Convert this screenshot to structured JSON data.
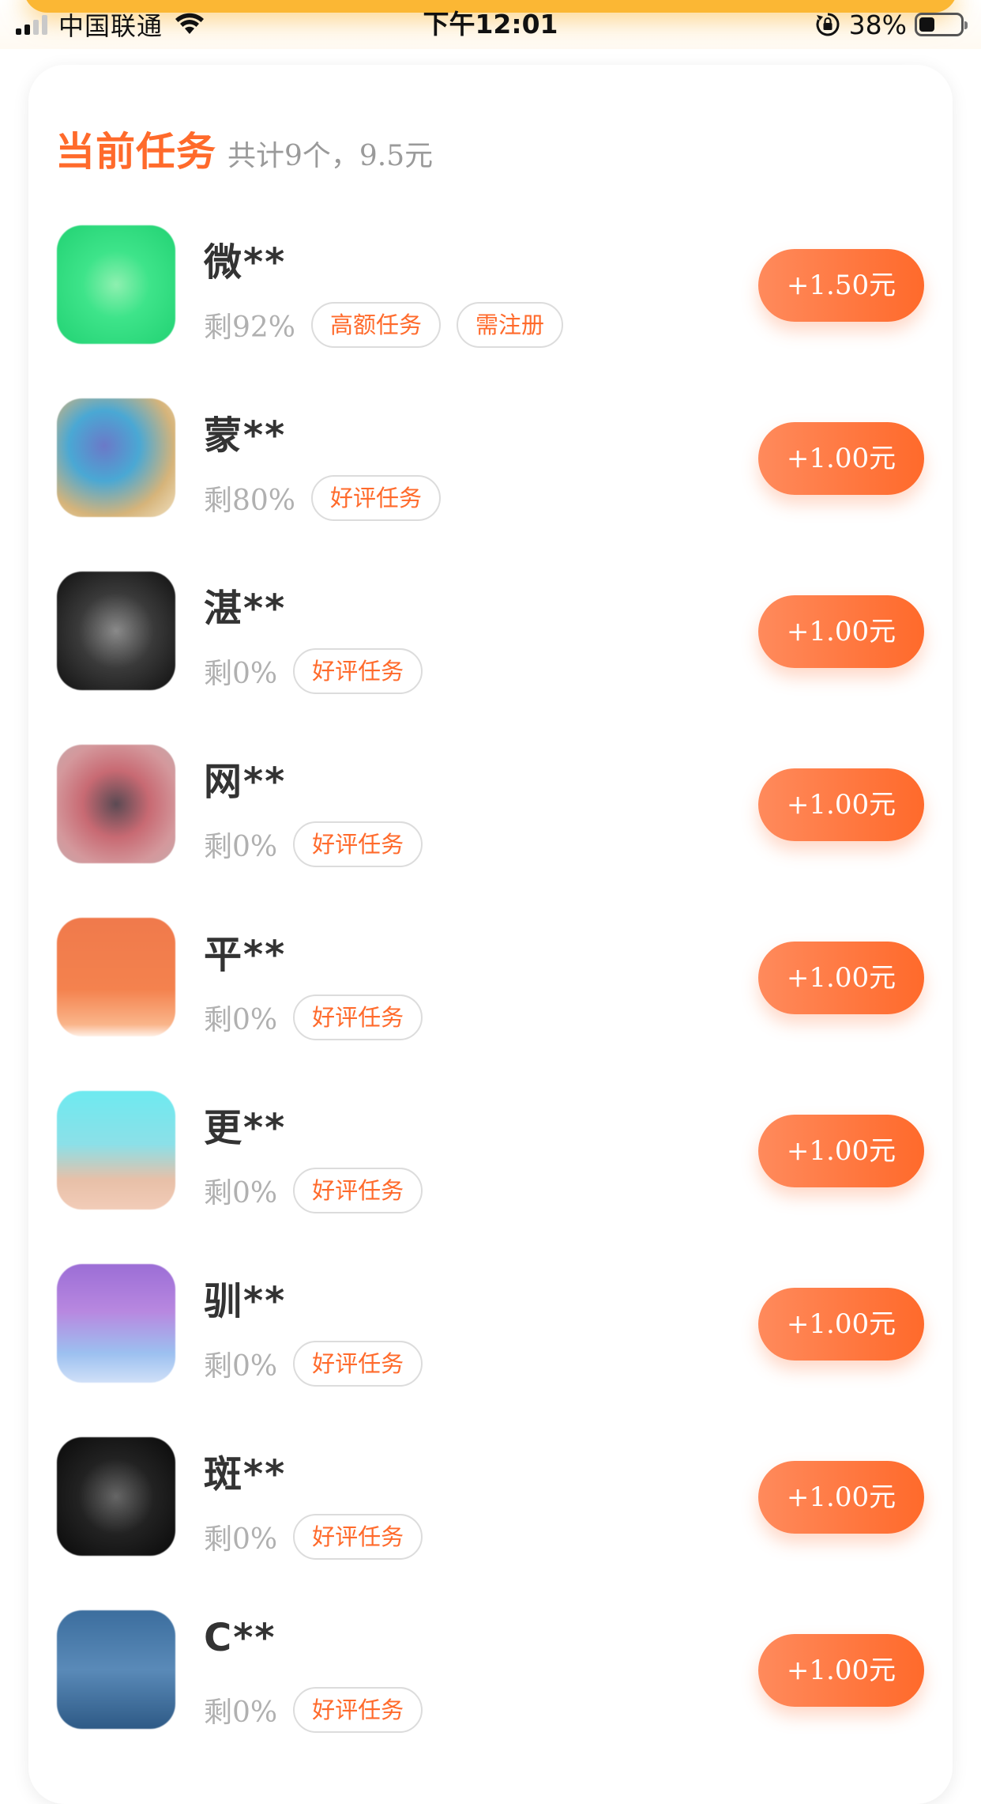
{
  "status_bar": {
    "carrier": "中国联通",
    "time": "下午12:01",
    "battery_percent": "38%",
    "battery_level": 0.38,
    "signal_bars": 2,
    "icons": [
      "signal-icon",
      "wifi-icon",
      "rotation-lock-icon",
      "battery-icon"
    ]
  },
  "header": {
    "title": "当前任务",
    "subtitle": "共计9个，9.5元"
  },
  "tasks": [
    {
      "name": "微**",
      "remain": "剩92%",
      "tags": [
        "高额任务",
        "需注册"
      ],
      "reward": "+1.50元",
      "icon": "wechat-app-icon"
    },
    {
      "name": "蒙**",
      "remain": "剩80%",
      "tags": [
        "好评任务"
      ],
      "reward": "+1.00元",
      "icon": "app-icon"
    },
    {
      "name": "湛**",
      "remain": "剩0%",
      "tags": [
        "好评任务"
      ],
      "reward": "+1.00元",
      "icon": "app-icon"
    },
    {
      "name": "网**",
      "remain": "剩0%",
      "tags": [
        "好评任务"
      ],
      "reward": "+1.00元",
      "icon": "app-icon"
    },
    {
      "name": "平**",
      "remain": "剩0%",
      "tags": [
        "好评任务"
      ],
      "reward": "+1.00元",
      "icon": "app-icon"
    },
    {
      "name": "更**",
      "remain": "剩0%",
      "tags": [
        "好评任务"
      ],
      "reward": "+1.00元",
      "icon": "app-icon"
    },
    {
      "name": "驯**",
      "remain": "剩0%",
      "tags": [
        "好评任务"
      ],
      "reward": "+1.00元",
      "icon": "app-icon"
    },
    {
      "name": "斑**",
      "remain": "剩0%",
      "tags": [
        "好评任务"
      ],
      "reward": "+1.00元",
      "icon": "app-icon"
    },
    {
      "name": "C**",
      "remain": "剩0%",
      "tags": [
        "好评任务"
      ],
      "reward": "+1.00元",
      "icon": "app-icon"
    }
  ],
  "colors": {
    "accent": "#ff6a2b",
    "button_gradient_start": "#ff8a5c",
    "button_gradient_end": "#ff6a2b",
    "muted_text": "#b0b0b0",
    "status_glow": "#fbb734"
  }
}
